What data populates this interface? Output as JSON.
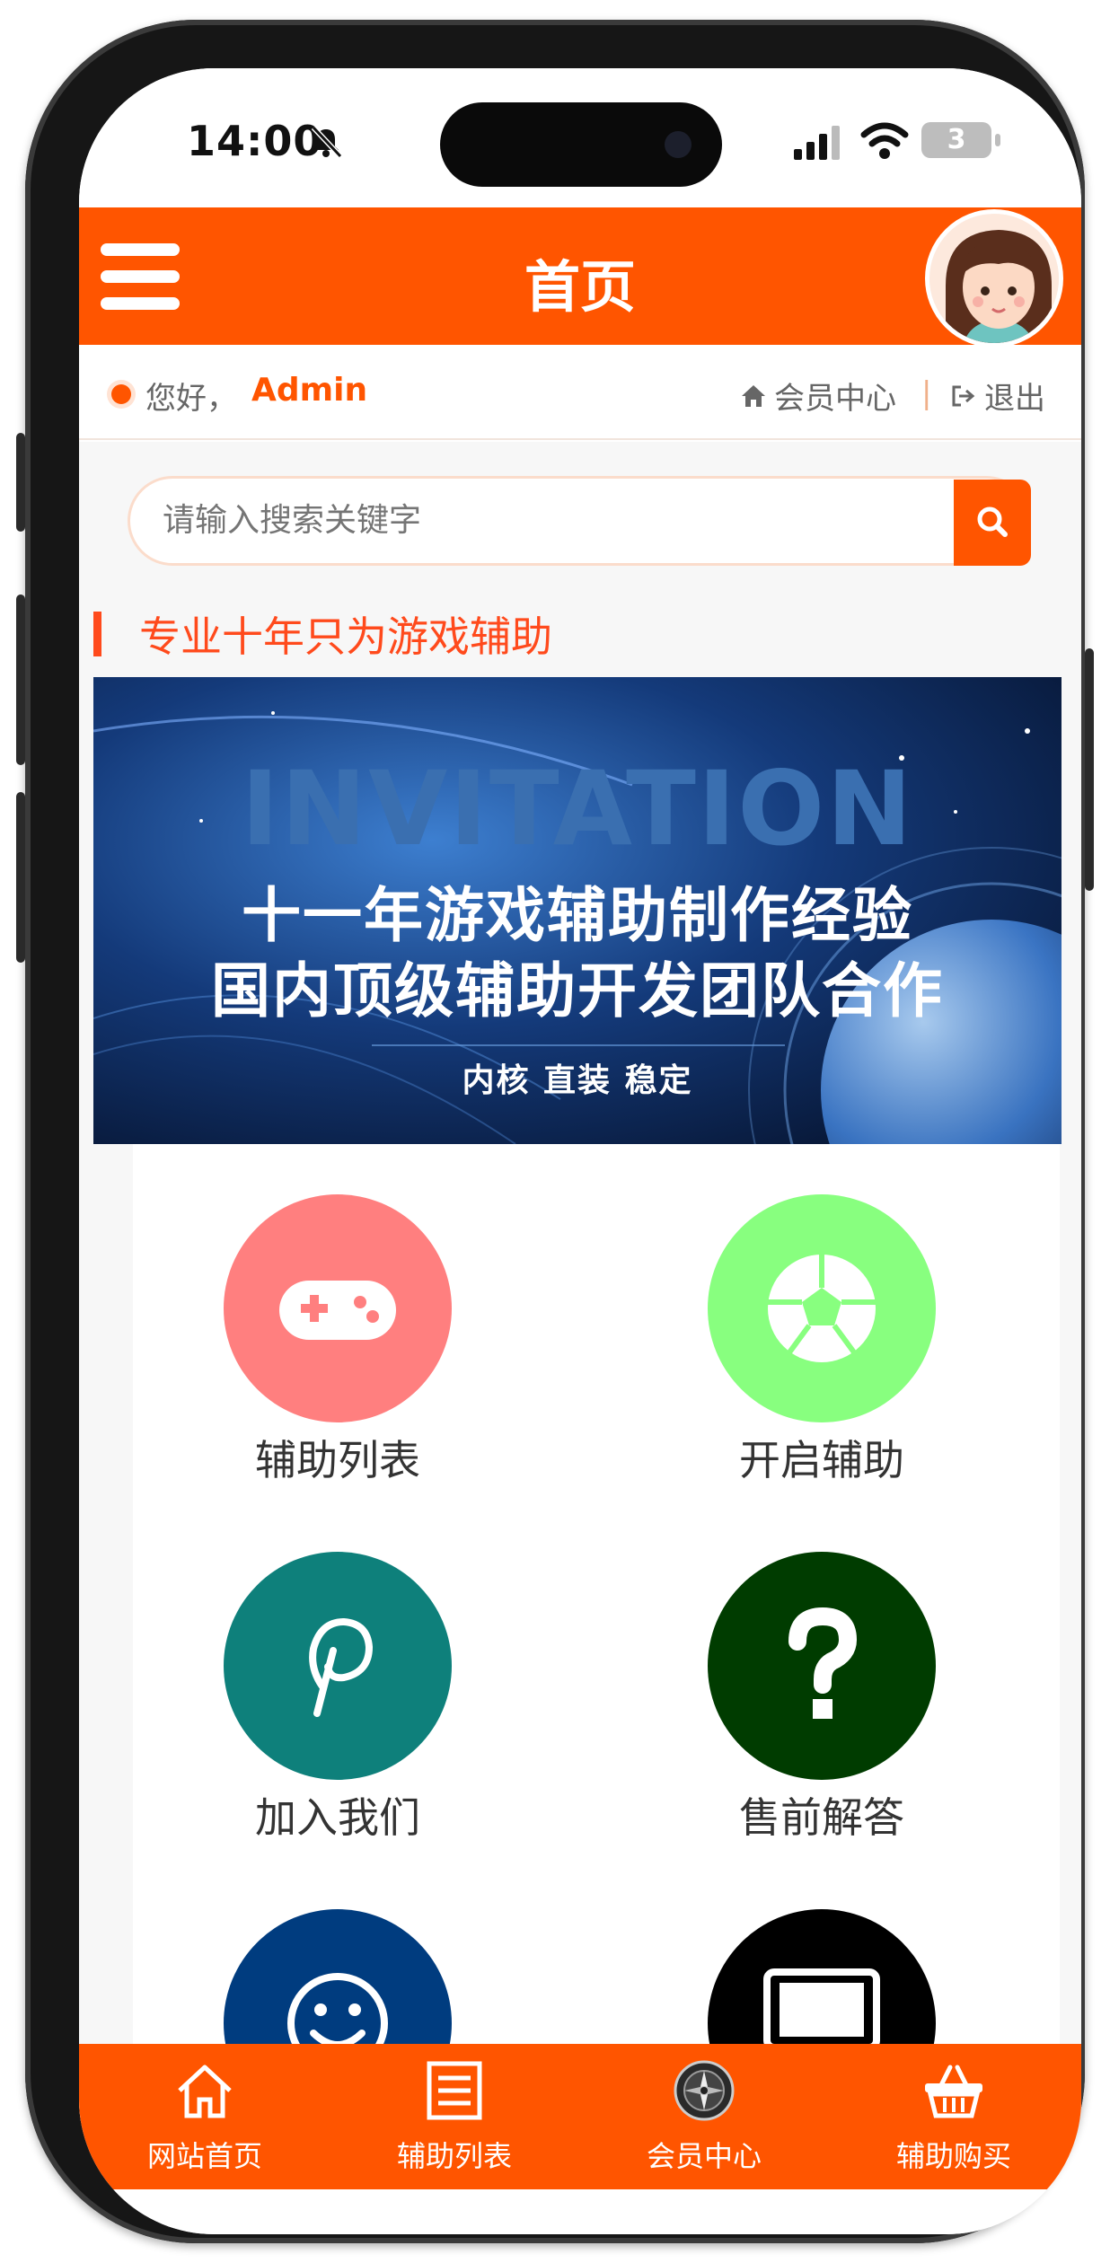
{
  "status_bar": {
    "time": "14:00",
    "battery": "3"
  },
  "header": {
    "title": "首页"
  },
  "greeting": {
    "hello": "您好，",
    "username": "Admin",
    "member_center": "会员中心",
    "separator": "|",
    "logout": "退出"
  },
  "search": {
    "placeholder": "请输入搜索关键字"
  },
  "section": {
    "title": "专业十年只为游戏辅助"
  },
  "banner": {
    "headline": "INVITATION",
    "line1": "十一年游戏辅助制作经验",
    "line2": "国内顶级辅助开发团队合作",
    "subline": "内核 直装 稳定"
  },
  "grid": {
    "items": [
      {
        "label": "辅助列表",
        "icon": "gamepad-icon",
        "color": "#ff7f7f"
      },
      {
        "label": "开启辅助",
        "icon": "soccer-ball-icon",
        "color": "#88ff7f"
      },
      {
        "label": "加入我们",
        "icon": "pinterest-icon",
        "color": "#0e807b"
      },
      {
        "label": "售前解答",
        "icon": "question-icon",
        "color": "#003c00"
      },
      {
        "label": "",
        "icon": "smile-icon",
        "color": "#003c7f"
      },
      {
        "label": "",
        "icon": "laptop-icon",
        "color": "#000000"
      }
    ]
  },
  "bottom_nav": {
    "items": [
      {
        "label": "网站首页",
        "icon": "home-icon"
      },
      {
        "label": "辅助列表",
        "icon": "list-icon"
      },
      {
        "label": "会员中心",
        "icon": "compass-icon"
      },
      {
        "label": "辅助购买",
        "icon": "basket-icon"
      }
    ]
  },
  "colors": {
    "brand": "#ff5500",
    "accent_title": "#ff4a1c"
  }
}
